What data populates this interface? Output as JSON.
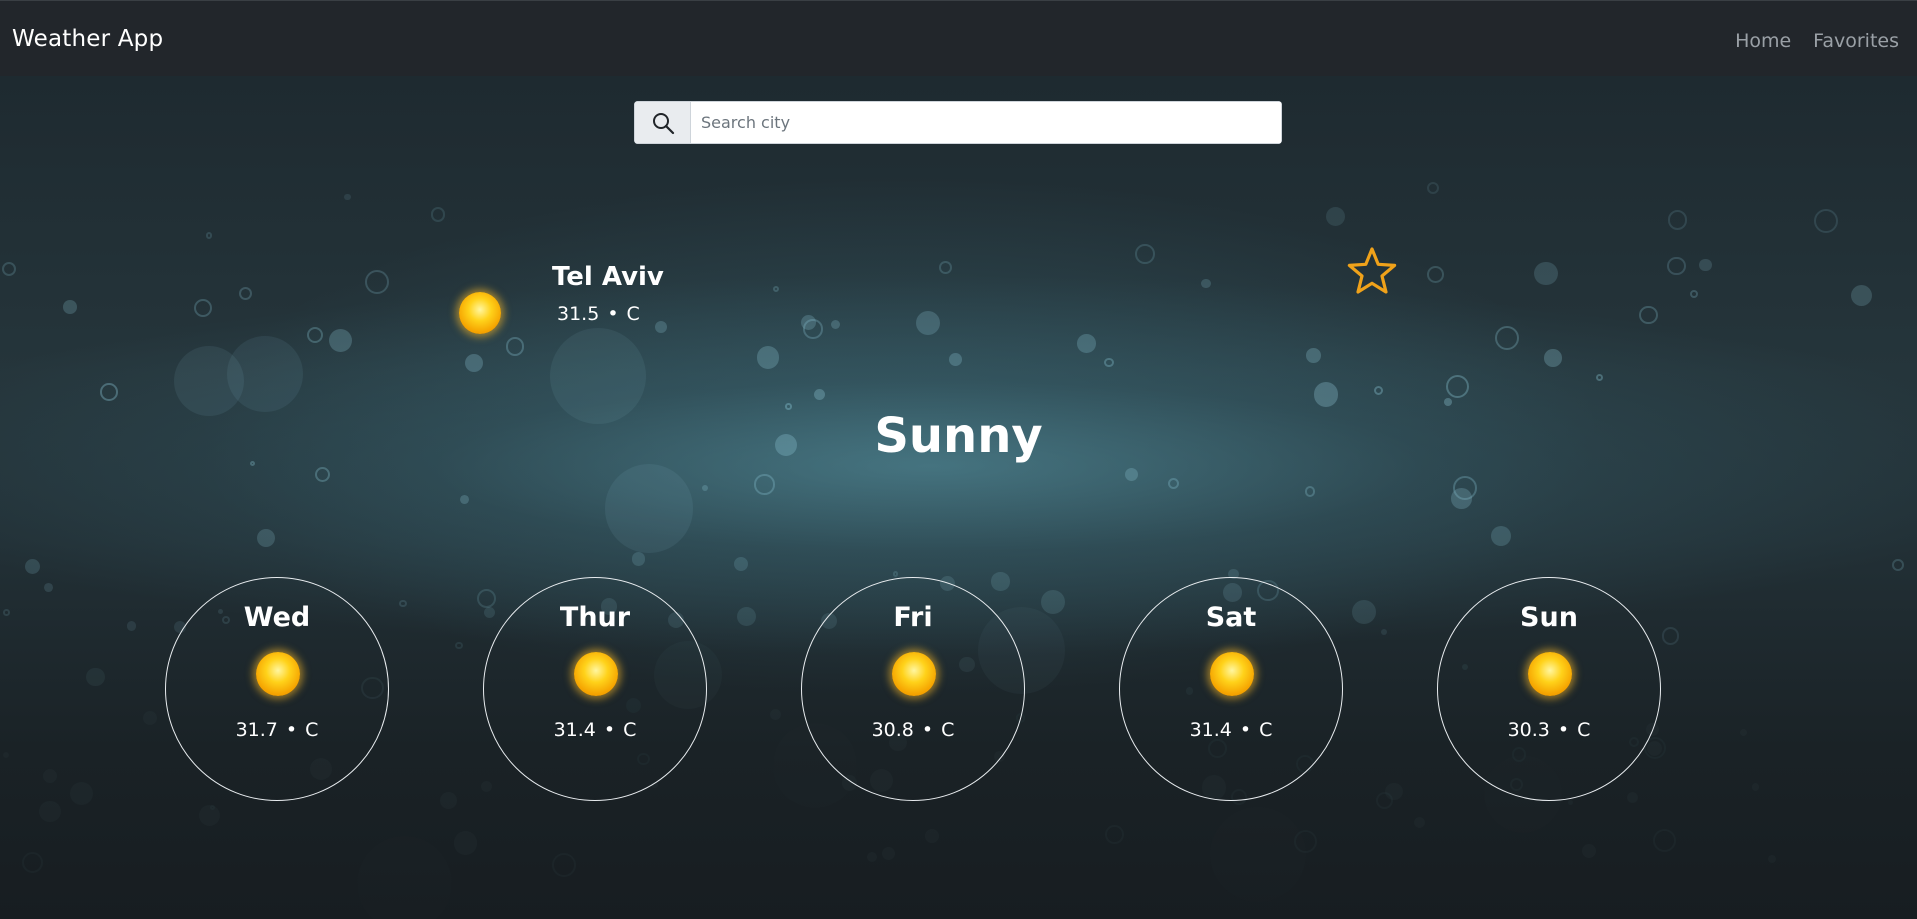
{
  "app": {
    "title": "Weather App"
  },
  "nav": {
    "items": [
      {
        "label": "Home"
      },
      {
        "label": "Favorites"
      }
    ]
  },
  "search": {
    "placeholder": "Search city",
    "value": ""
  },
  "current": {
    "city": "Tel Aviv",
    "temperature": "31.5",
    "unit": "C",
    "separator": "•",
    "condition": "Sunny",
    "icon": "sun-icon"
  },
  "favorite": {
    "icon": "star-outline-icon",
    "color": "#f0a21a",
    "active": false
  },
  "forecast": [
    {
      "day": "Wed",
      "temperature": "31.7",
      "unit": "C",
      "icon": "sun-icon"
    },
    {
      "day": "Thur",
      "temperature": "31.4",
      "unit": "C",
      "icon": "sun-icon"
    },
    {
      "day": "Fri",
      "temperature": "30.8",
      "unit": "C",
      "icon": "sun-icon"
    },
    {
      "day": "Sat",
      "temperature": "31.4",
      "unit": "C",
      "icon": "sun-icon"
    },
    {
      "day": "Sun",
      "temperature": "30.3",
      "unit": "C",
      "icon": "sun-icon"
    }
  ]
}
